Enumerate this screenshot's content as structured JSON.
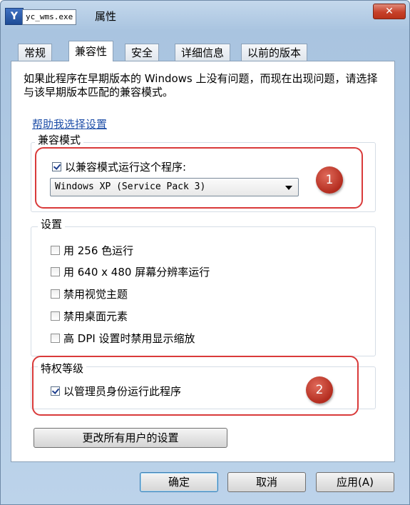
{
  "window": {
    "exe_name": "yc_wms.exe",
    "title": "属性",
    "close_glyph": "✕",
    "icon": "app-icon",
    "icon_text": "Y"
  },
  "tabs": [
    {
      "label": "常规",
      "active": false
    },
    {
      "label": "兼容性",
      "active": true
    },
    {
      "label": "安全",
      "active": false
    },
    {
      "label": "详细信息",
      "active": false
    },
    {
      "label": "以前的版本",
      "active": false
    }
  ],
  "description": "如果此程序在早期版本的 Windows 上没有问题，而现在出现问题，请选择与该早期版本匹配的兼容模式。",
  "help_link": "帮助我选择设置",
  "compat_mode": {
    "group_title": "兼容模式",
    "checkbox_label": "以兼容模式运行这个程序:",
    "checked": true,
    "selected_os": "Windows XP (Service Pack 3)"
  },
  "settings": {
    "group_title": "设置",
    "options": [
      {
        "label": "用 256 色运行",
        "checked": false
      },
      {
        "label": "用 640 x 480 屏幕分辨率运行",
        "checked": false
      },
      {
        "label": "禁用视觉主题",
        "checked": false
      },
      {
        "label": "禁用桌面元素",
        "checked": false
      },
      {
        "label": "高 DPI 设置时禁用显示缩放",
        "checked": false
      }
    ]
  },
  "privilege": {
    "group_title": "特权等级",
    "checkbox_label": "以管理员身份运行此程序",
    "checked": true
  },
  "change_all_users_button": "更改所有用户的设置",
  "footer": {
    "ok": "确定",
    "cancel": "取消",
    "apply": "应用(A)"
  },
  "annotations": [
    {
      "number": "1"
    },
    {
      "number": "2"
    }
  ],
  "colors": {
    "annotation": "#d93a3a",
    "link": "#1f4fa8",
    "titlebar": "#a9c4e0"
  }
}
